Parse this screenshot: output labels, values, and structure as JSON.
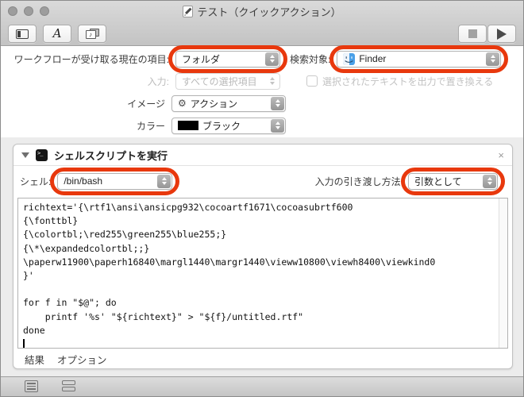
{
  "window": {
    "title": "テスト（クイックアクション）"
  },
  "settings": {
    "workflow_receives_label": "ワークフローが受け取る現在の項目:",
    "workflow_receives_value": "フォルダ",
    "search_scope_label": "検索対象:",
    "search_scope_value": "Finder",
    "input_label": "入力:",
    "input_value": "すべての選択項目",
    "replace_text_checkbox_label": "選択されたテキストを出力で置き換える",
    "replace_text_checked": false,
    "image_label": "イメージ",
    "image_value": "アクション",
    "color_label": "カラー",
    "color_value": "ブラック",
    "color_swatch": "#000000"
  },
  "action": {
    "title": "シェルスクリプトを実行",
    "close_label": "×",
    "shell_label": "シェル:",
    "shell_value": "/bin/bash",
    "pass_input_label": "入力の引き渡し方法:",
    "pass_input_value": "引数として",
    "script": "richtext='{\\rtf1\\ansi\\ansicpg932\\cocoartf1671\\cocoasubrtf600\n{\\fonttbl}\n{\\colortbl;\\red255\\green255\\blue255;}\n{\\*\\expandedcolortbl;;}\n\\paperw11900\\paperh16840\\margl1440\\margr1440\\vieww10800\\viewh8400\\viewkind0\n}'\n\nfor f in \"$@\"; do\n    printf '%s' \"${richtext}\" > \"${f}/untitled.rtf\"\ndone\n",
    "results_label": "結果",
    "options_label": "オプション"
  },
  "annotations": {
    "highlight_color": "#e8380d"
  }
}
